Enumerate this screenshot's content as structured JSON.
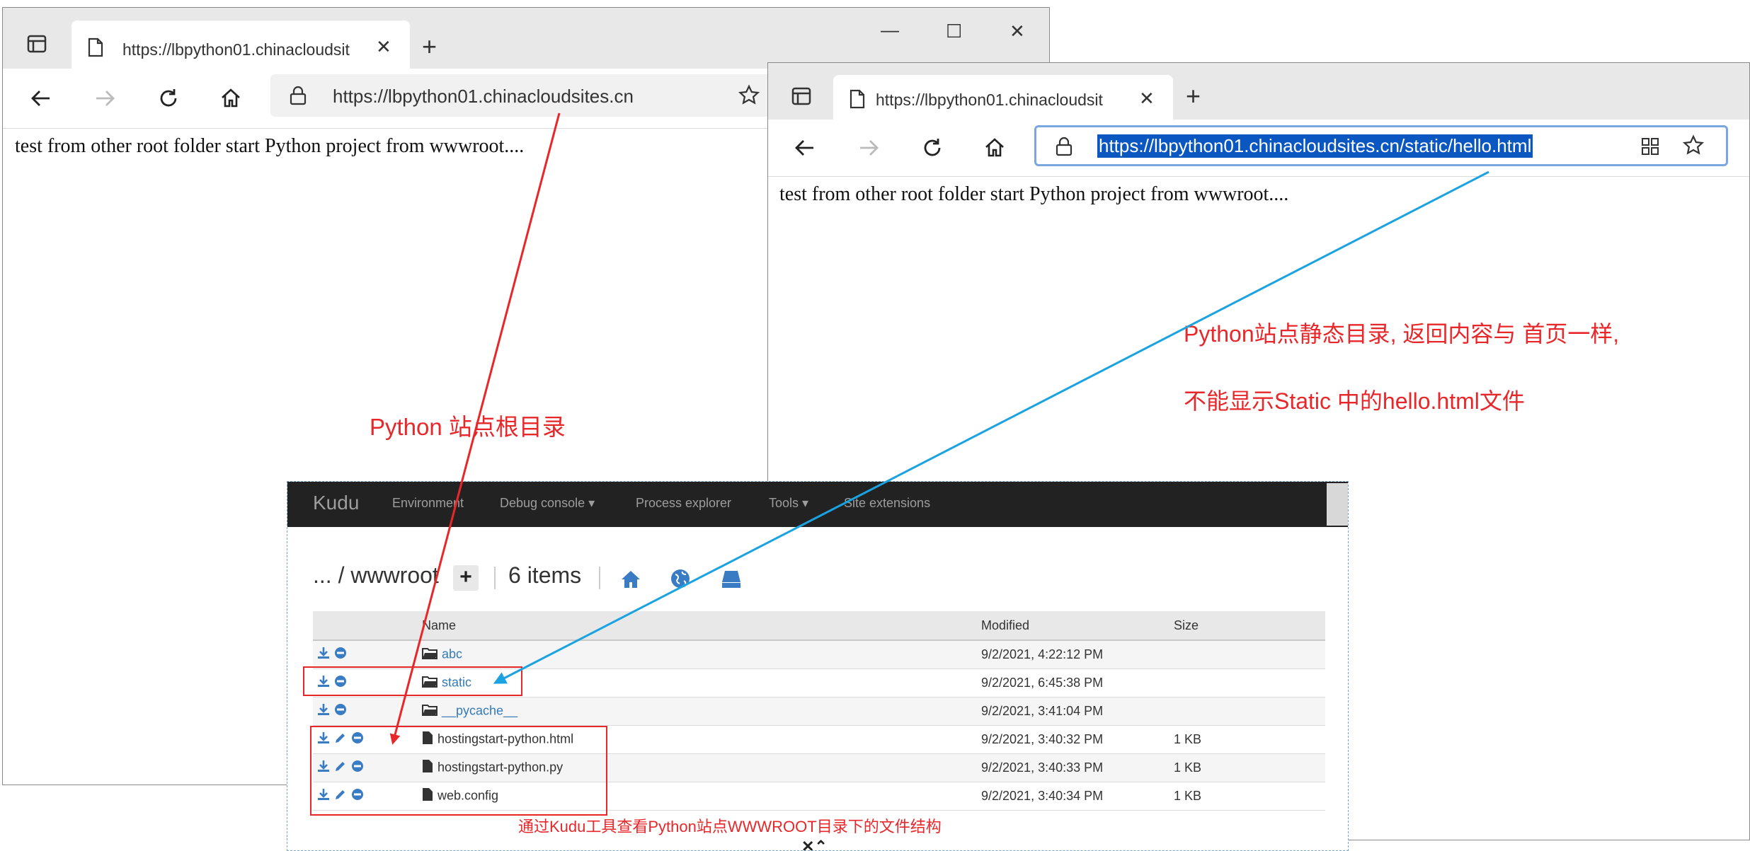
{
  "browser_back": {
    "tab_title": "https://lbpython01.chinacloudsit",
    "url_host": "https://lbpython01.chinacloudsites.cn",
    "page_text": "test from other root folder start Python project from wwwroot...."
  },
  "browser_front": {
    "tab_title": "https://lbpython01.chinacloudsit",
    "url": "https://lbpython01.chinacloudsites.cn/static/hello.html",
    "page_text": "test from other root folder start Python project from wwwroot...."
  },
  "annotations": {
    "root_label": "Python 站点根目录",
    "static_line1": "Python站点静态目录, 返回内容与 首页一样,",
    "static_line2": "不能显示Static 中的hello.html文件",
    "kudu_caption": "通过Kudu工具查看Python站点WWWROOT目录下的文件结构"
  },
  "kudu": {
    "brand": "Kudu",
    "nav": [
      "Environment",
      "Debug console ▾",
      "Process explorer",
      "Tools ▾",
      "Site extensions"
    ],
    "breadcrumb": "... / wwwroot",
    "add_label": "+",
    "item_count": "6 items",
    "columns": [
      "Name",
      "Modified",
      "Size"
    ],
    "rows": [
      {
        "name": "abc",
        "modified": "9/2/2021, 4:22:12 PM",
        "size": ""
      },
      {
        "name": "static",
        "modified": "9/2/2021, 6:45:38 PM",
        "size": ""
      },
      {
        "name": "__pycache__",
        "modified": "9/2/2021, 3:41:04 PM",
        "size": ""
      },
      {
        "name": "hostingstart-python.html",
        "modified": "9/2/2021, 3:40:32 PM",
        "size": "1 KB"
      },
      {
        "name": "hostingstart-python.py",
        "modified": "9/2/2021, 3:40:33 PM",
        "size": "1 KB"
      },
      {
        "name": "web.config",
        "modified": "9/2/2021, 3:40:34 PM",
        "size": "1 KB"
      }
    ]
  },
  "colors": {
    "annotation_red": "#e8272a",
    "arrow_blue": "#1aa3e0",
    "kudu_nav": "#222222",
    "link": "#337ab7"
  }
}
